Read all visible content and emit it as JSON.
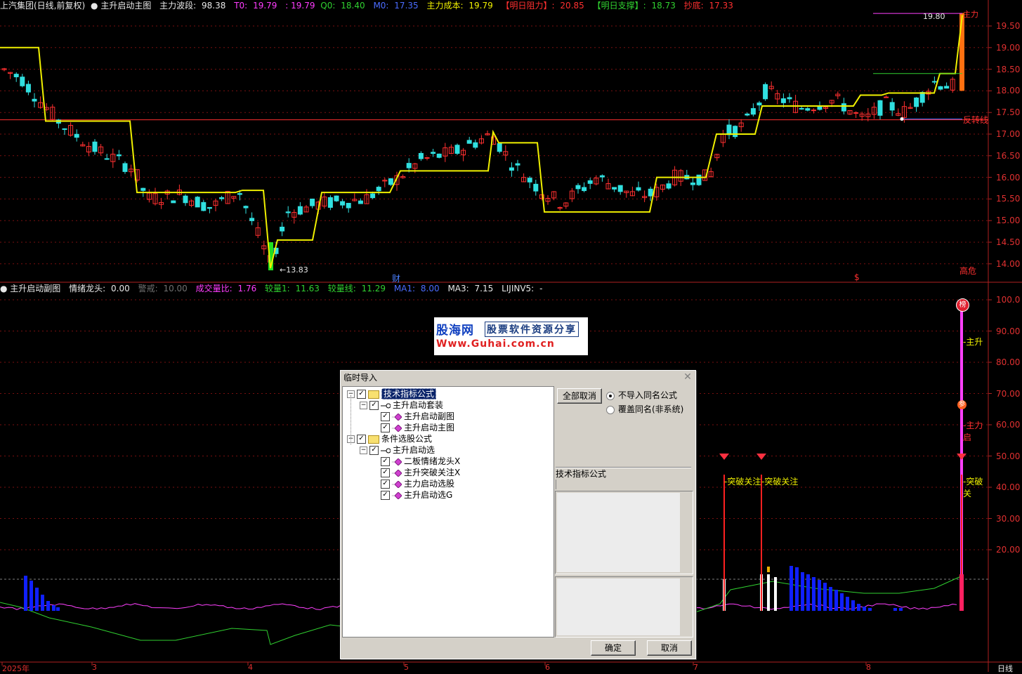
{
  "main_header": {
    "title": "上汽集团(日线,前复权)",
    "indicator": "主升启动主图",
    "zhuli_label": "主力波段:",
    "zhuli_value": "98.38",
    "t0_label": "T0:",
    "t0_value": "19.79",
    "sep_value": ": 19.79",
    "q0_label": "Q0:",
    "q0_value": "18.40",
    "m0_label": "M0:",
    "m0_value": "17.35",
    "cost_label": "主力成本:",
    "cost_value": "19.79",
    "resist_label": "【明日阻力】:",
    "resist_value": "20.85",
    "support_label": "【明日支撑】:",
    "support_value": "18.73",
    "bottom_label": "抄底:",
    "bottom_value": "17.33"
  },
  "sub_header": {
    "indicator": "主升启动副图",
    "qx_label": "情绪龙头:",
    "qx_value": "0.00",
    "jb_label": "警戒:",
    "jb_value": "10.00",
    "vr_label": "成交量比:",
    "vr_value": "1.76",
    "jl1_label": "较量1:",
    "jl1_value": "11.63",
    "jlx_label": "较量线:",
    "jlx_value": "11.29",
    "ma1_label": "MA1:",
    "ma1_value": "8.00",
    "ma3_label": "MA3:",
    "ma3_value": "7.15",
    "lj_label": "LIJINV5:",
    "lj_value": "-"
  },
  "main_axis": [
    "19.50",
    "19.00",
    "18.50",
    "18.00",
    "17.50",
    "17.00",
    "16.50",
    "16.00",
    "15.50",
    "15.00",
    "14.50",
    "14.00"
  ],
  "sub_axis": [
    "100.0",
    "90.00",
    "80.00",
    "70.00",
    "60.00",
    "50.00",
    "40.00",
    "30.00",
    "20.00"
  ],
  "x_axis": [
    "2025年",
    "3",
    "4",
    "5",
    "6",
    "7",
    "8"
  ],
  "period_label": "日线",
  "annotations": {
    "low_price": "13.83",
    "high_price": "19.80",
    "reversal_line": "反转线",
    "cai": "财",
    "danger": "高危",
    "dollar": "$",
    "zhuli_top": "主力",
    "breakthrough1": "突破关注",
    "breakthrough2": "突破关注",
    "breakthrough3": "突破关",
    "zhusheng": "主升",
    "zhuli_mid": "主力启",
    "bang": "榜",
    "cen": "参"
  },
  "watermark": {
    "brand": "股海网",
    "slogan": "股票软件资源分享",
    "url": "Www.Guhai.com.cn"
  },
  "dialog": {
    "title": "临时导入",
    "tree": [
      {
        "label": "技术指标公式",
        "level": 0,
        "type": "folder"
      },
      {
        "label": "主升启动套装",
        "level": 1,
        "type": "key"
      },
      {
        "label": "主升启动副图",
        "level": 2,
        "type": "item"
      },
      {
        "label": "主升启动主图",
        "level": 2,
        "type": "item"
      },
      {
        "label": "条件选股公式",
        "level": 0,
        "type": "folder"
      },
      {
        "label": "主升启动选",
        "level": 1,
        "type": "key"
      },
      {
        "label": "二板情绪龙头X",
        "level": 2,
        "type": "item"
      },
      {
        "label": "主升突破关注X",
        "level": 2,
        "type": "item"
      },
      {
        "label": "主力启动选股",
        "level": 2,
        "type": "item"
      },
      {
        "label": "主升启动选G",
        "level": 2,
        "type": "item"
      }
    ],
    "cancel_all": "全部取消",
    "radio_no_import": "不导入同名公式",
    "radio_overwrite": "覆盖同名(非系统)",
    "category_label": "技术指标公式",
    "ok": "确定",
    "cancel": "取消"
  },
  "colors": {
    "up": "#ff3030",
    "down": "#30e0e0",
    "yellow_line": "#f0f000",
    "grid": "#7a1010",
    "volume_blue": "#1020ff",
    "magenta": "#ff40ff",
    "green_line": "#30d030"
  }
}
